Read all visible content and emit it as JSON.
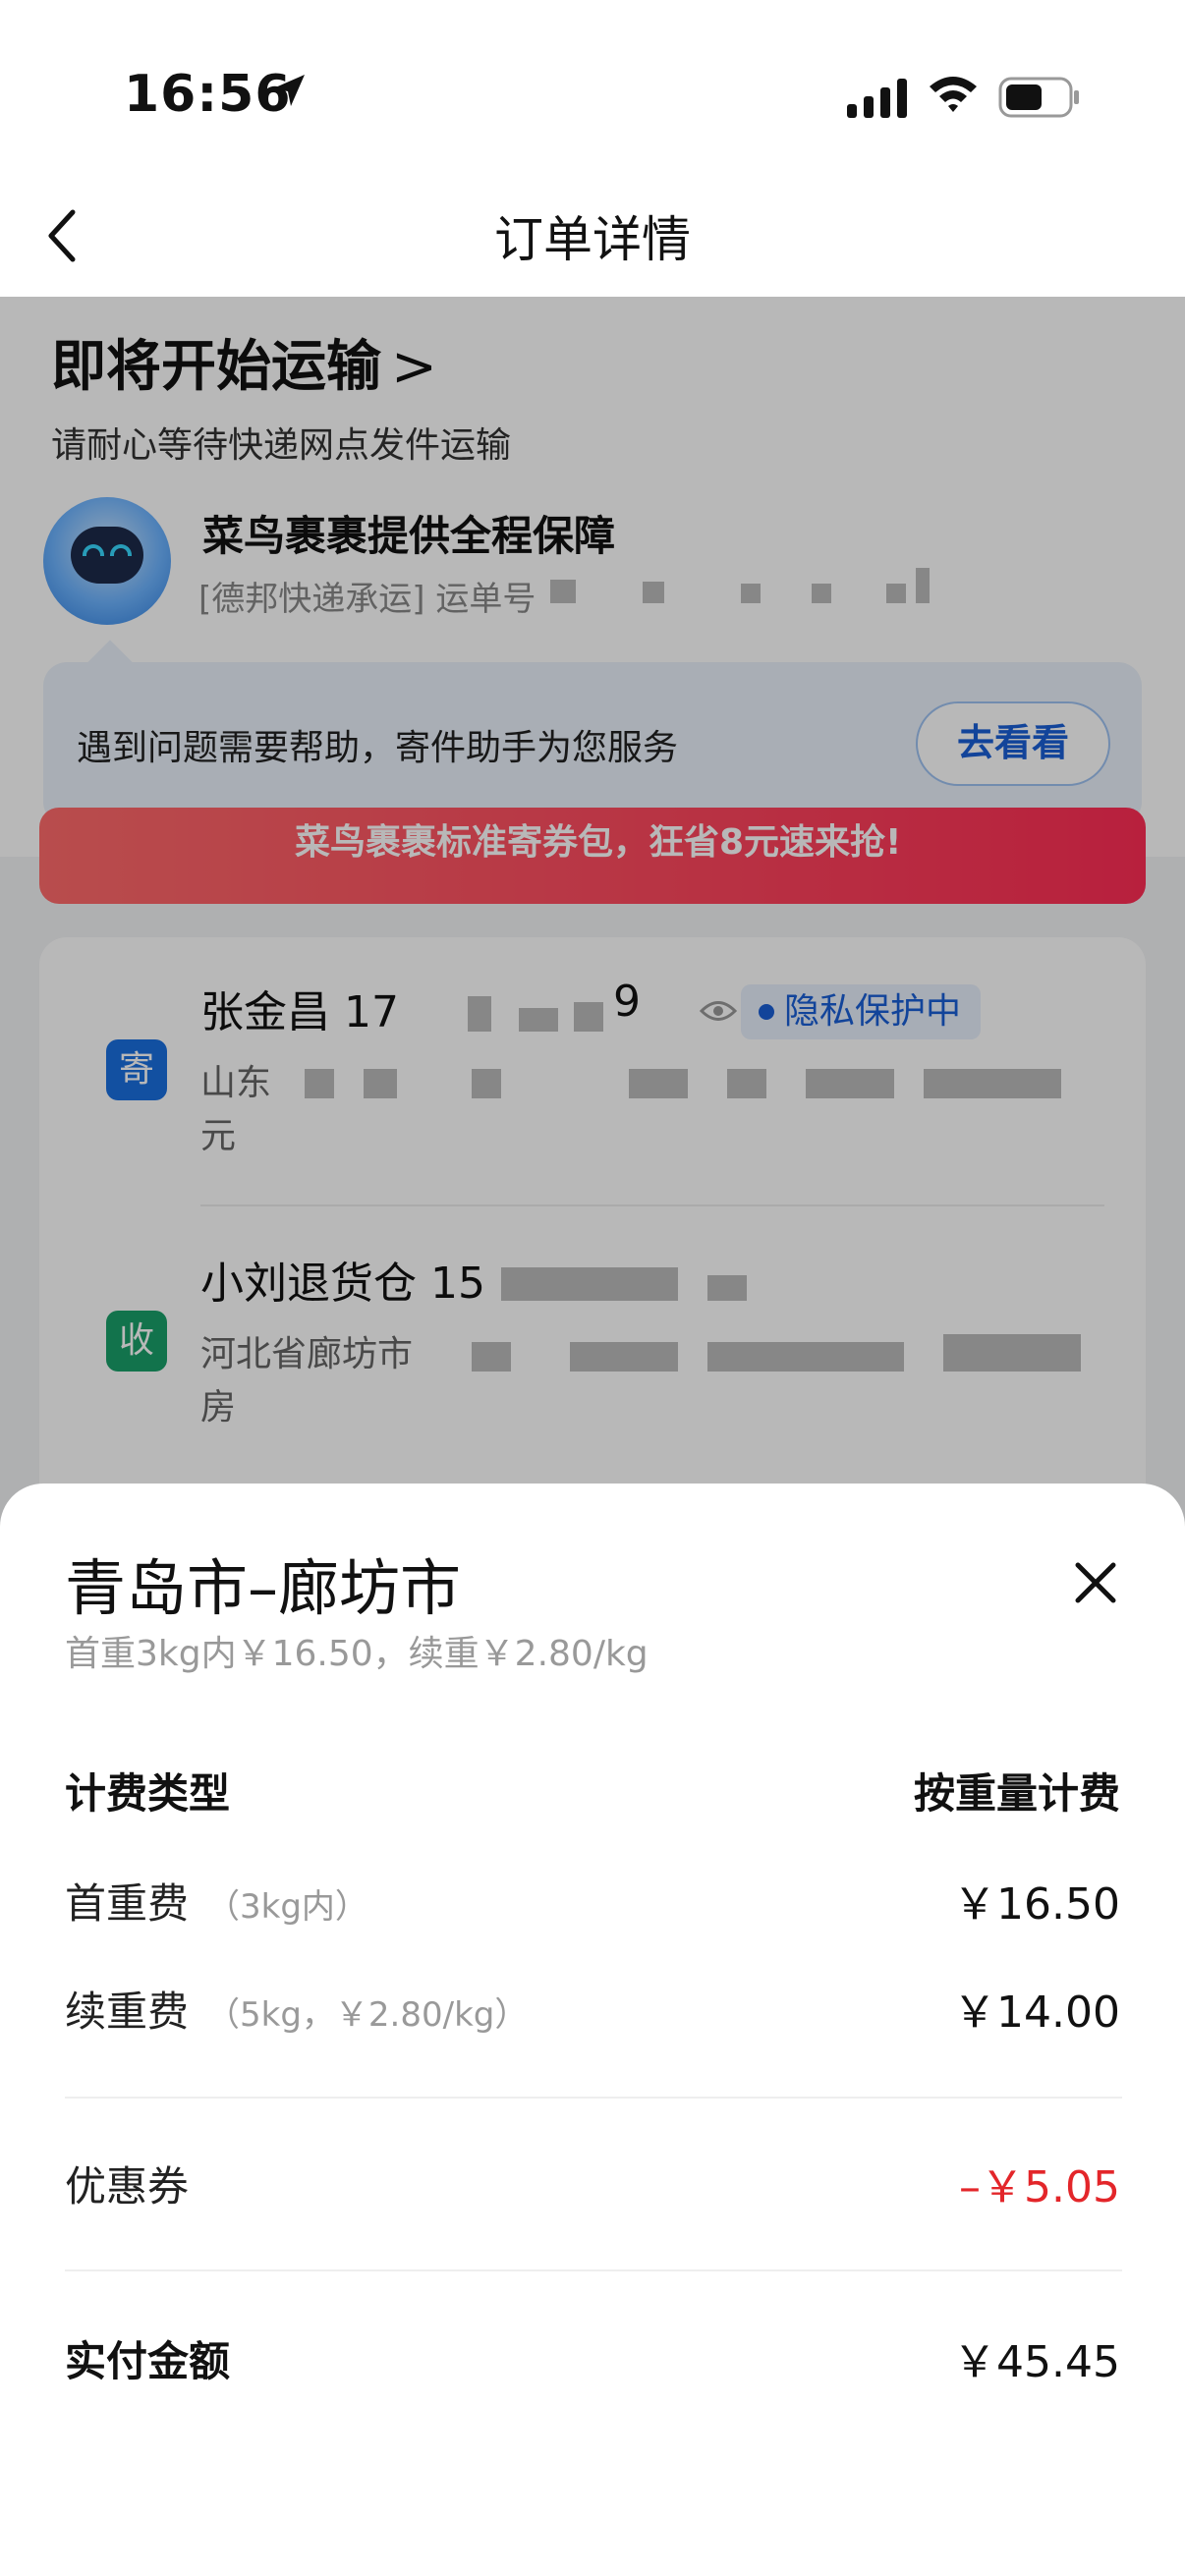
{
  "status_bar": {
    "time": "16:56"
  },
  "nav": {
    "title": "订单详情"
  },
  "shipment": {
    "status": "即将开始运输",
    "chevron": ">",
    "status_sub": "请耐心等待快递网点发件运输",
    "guarantee_title": "菜鸟裹裹提供全程保障",
    "carrier_line": "[德邦快递承运] 运单号"
  },
  "help": {
    "text": "遇到问题需要帮助，寄件助手为您服务",
    "button": "去看看"
  },
  "banner": {
    "text": "菜鸟裹裹标准寄券包，狂省8元速来抢!"
  },
  "sender": {
    "badge": "寄",
    "name": "张金昌 17",
    "tail": "9",
    "privacy": "隐私保护中",
    "address_start": "山东",
    "address_end": "元"
  },
  "receiver": {
    "badge": "收",
    "name": "小刘退货仓 15",
    "address_start": "河北省廊坊市",
    "address_end": "房"
  },
  "sheet": {
    "title": "青岛市–廊坊市",
    "subtitle": "首重3kg内￥16.50，续重￥2.80/kg",
    "rows": [
      {
        "label": "计费类型",
        "note": "",
        "value": "按重量计费"
      },
      {
        "label": "首重费",
        "note": "（3kg内）",
        "value": "￥16.50"
      },
      {
        "label": "续重费",
        "note": "（5kg，￥2.80/kg）",
        "value": "￥14.00"
      },
      {
        "label": "优惠券",
        "note": "",
        "value": "–￥5.05"
      },
      {
        "label": "实付金额",
        "note": "",
        "value": "￥45.45"
      }
    ]
  },
  "colors": {
    "accent_blue": "#1a5fd6",
    "discount_red": "#e3262a",
    "sender_badge": "#1a6fe0",
    "receiver_badge": "#1aa06a"
  }
}
